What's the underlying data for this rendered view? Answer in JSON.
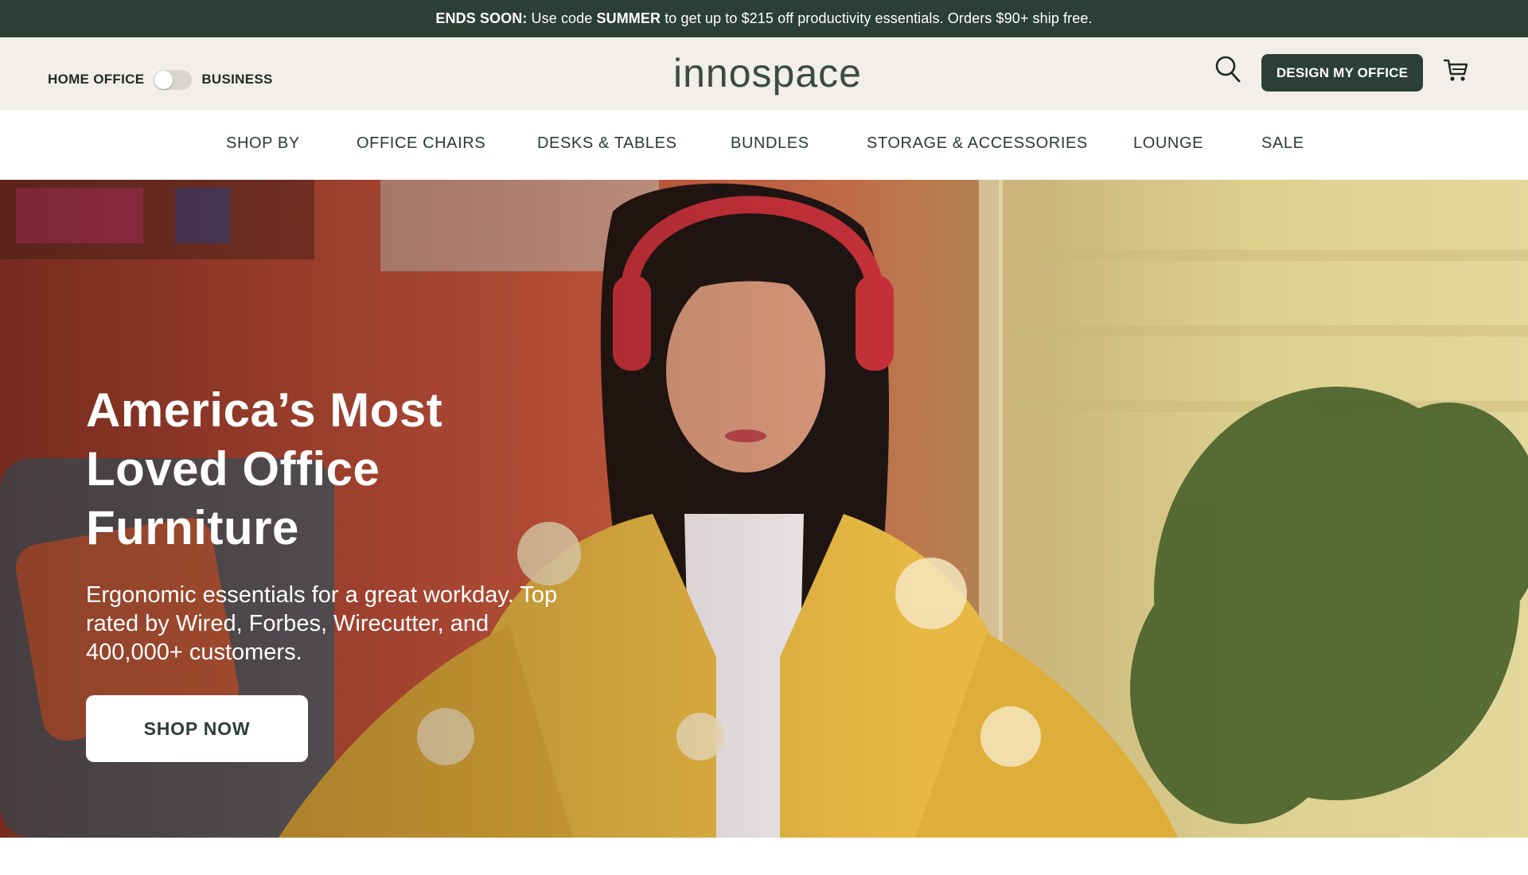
{
  "promo": {
    "lead": "ENDS SOON:",
    "text_a": " Use code ",
    "code": "SUMMER",
    "text_b": " to get up to $215 off productivity essentials. Orders $90+ ship free."
  },
  "header": {
    "toggle_left": "HOME OFFICE",
    "toggle_right": "BUSINESS",
    "toggle_state": "off",
    "logo": "innospace",
    "cta": "DESIGN MY OFFICE",
    "icons": {
      "search": "search-icon",
      "cart": "cart-icon"
    }
  },
  "nav": {
    "items": [
      "SHOP BY",
      "OFFICE CHAIRS",
      "DESKS & TABLES",
      "BUNDLES",
      "STORAGE & ACCESSORIES",
      "LOUNGE",
      "SALE"
    ]
  },
  "hero": {
    "title_lines": [
      "America’s Most",
      "Loved Office",
      "Furniture"
    ],
    "subtitle": "Ergonomic essentials for a great workday. Top rated by Wired, Forbes, Wirecutter, and 400,000+ customers.",
    "button": "SHOP NOW"
  },
  "colors": {
    "brand_dark": "#2b3f36",
    "header_bg": "#f2efeb",
    "hero_text": "#ffffff"
  }
}
